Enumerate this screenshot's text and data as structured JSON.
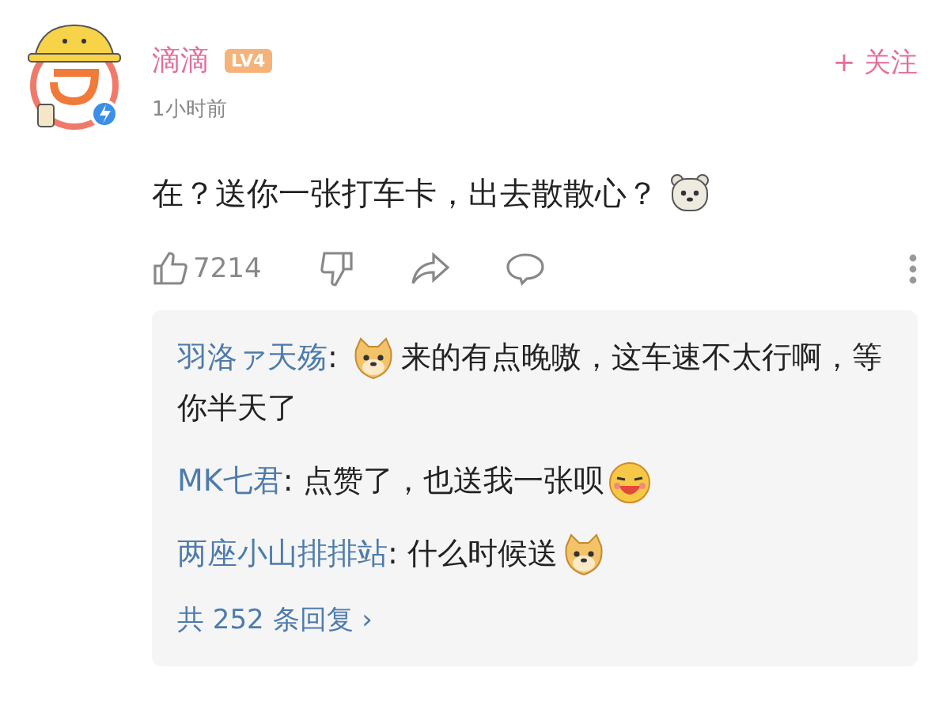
{
  "post": {
    "author": "滴滴",
    "level_badge": "LV4",
    "time": "1小时前",
    "follow_button": "+ 关注",
    "verified": true
  },
  "comment": {
    "segments": [
      {
        "kind": "text",
        "text": "在？送你一张打车卡，出去散散心？"
      },
      {
        "kind": "bear"
      }
    ]
  },
  "actions": {
    "like_count": "7214"
  },
  "replies": [
    {
      "author": "羽洛ァ天殇",
      "separator": ":",
      "segments": [
        {
          "kind": "doge"
        },
        {
          "kind": "text",
          "text": "来的有点晚嗷，这车速不太行啊，等你半天了"
        }
      ]
    },
    {
      "author": "MK七君",
      "separator": ":",
      "segments": [
        {
          "kind": "text",
          "text": "点赞了，也送我一张呗"
        },
        {
          "kind": "laugh"
        }
      ]
    },
    {
      "author": "两座小山排排站",
      "separator": ":",
      "segments": [
        {
          "kind": "text",
          "text": "什么时候送"
        },
        {
          "kind": "doge"
        }
      ]
    }
  ],
  "more_replies": "共 252 条回复 ›"
}
